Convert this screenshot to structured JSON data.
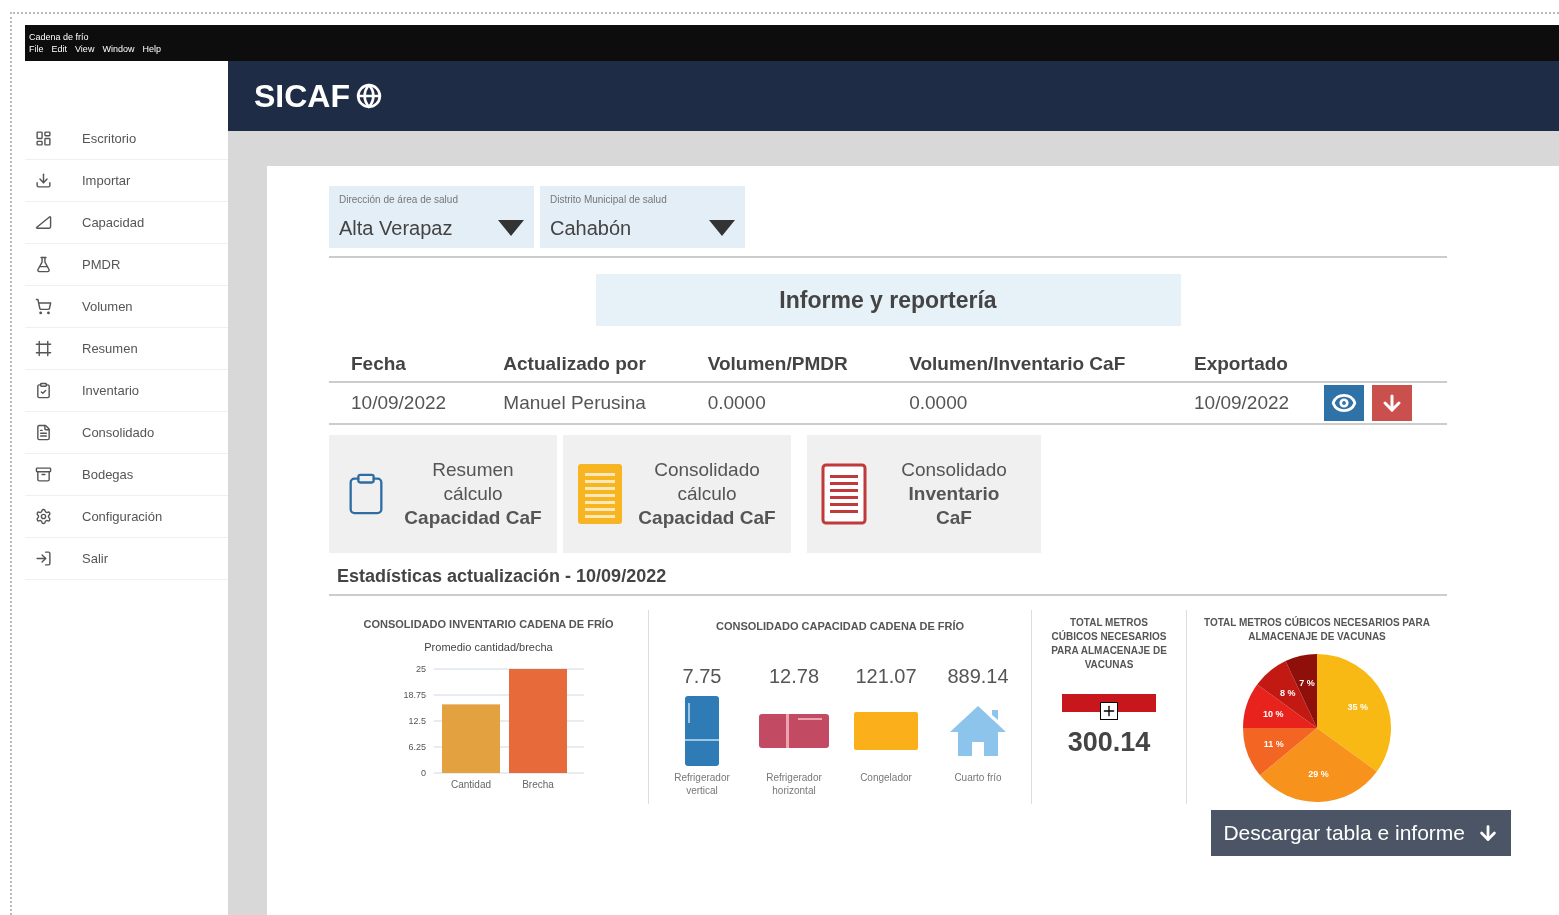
{
  "window": {
    "title": "Cadena de frío",
    "menu": [
      "File",
      "Edit",
      "View",
      "Window",
      "Help"
    ]
  },
  "header": {
    "logo": "SICAF"
  },
  "sidebar": {
    "items": [
      {
        "label": "Escritorio",
        "kind": "dashboard",
        "selected": false
      },
      {
        "label": "Importar",
        "kind": "import",
        "selected": false
      },
      {
        "label": "Capacidad",
        "kind": "capacity",
        "selected": false
      },
      {
        "label": "PMDR",
        "kind": "pmdr",
        "selected": false
      },
      {
        "label": "Volumen",
        "kind": "volume",
        "selected": false
      },
      {
        "label": "Resumen",
        "kind": "summary",
        "selected": false
      },
      {
        "label": "Inventario",
        "kind": "inventory",
        "selected": false
      },
      {
        "label": "Consolidado",
        "kind": "consolidated",
        "selected": false
      },
      {
        "label": "Bodegas",
        "kind": "warehouse",
        "selected": false
      },
      {
        "label": "Configuración",
        "kind": "settings",
        "selected": false
      },
      {
        "label": "Salir",
        "kind": "exit",
        "selected": false
      }
    ]
  },
  "filters": [
    {
      "label": "Dirección de área de salud",
      "value": "Alta Verapaz"
    },
    {
      "label": "Distrito Municipal de salud",
      "value": "Cahabón"
    }
  ],
  "section_title": "Informe y reportería",
  "table": {
    "columns": [
      "Fecha",
      "Actualizado por",
      "Volumen/PMDR",
      "Volumen/Inventario CaF",
      "Exportado"
    ],
    "rows": [
      {
        "cells": [
          "10/09/2022",
          "Manuel Perusina",
          "0.0000",
          "0.0000",
          "10/09/2022"
        ]
      }
    ]
  },
  "report_cards": [
    {
      "kind": "clipboard",
      "lines": [
        {
          "text": "Resumen",
          "bold": false
        },
        {
          "text": "cálculo",
          "bold": false
        },
        {
          "text": "Capacidad CaF",
          "bold": true
        }
      ]
    },
    {
      "kind": "list",
      "lines": [
        {
          "text": "Consolidado",
          "bold": false
        },
        {
          "text": "cálculo",
          "bold": false
        },
        {
          "text": "Capacidad CaF",
          "bold": true
        }
      ]
    },
    {
      "kind": "document",
      "lines": [
        {
          "text": "Consolidado",
          "bold": false
        },
        {
          "text": "Inventario",
          "bold": true
        },
        {
          "text": "CaF",
          "bold": true
        }
      ]
    }
  ],
  "stats_title": "Estadísticas actualización - 10/09/2022",
  "inventory_panel": {
    "title": "CONSOLIDADO INVENTARIO CADENA DE FRÍO",
    "chart_data": {
      "type": "bar",
      "grid": true,
      "title": "Promedio cantidad/brecha",
      "categories": [
        "Cantidad",
        "Brecha"
      ],
      "values": [
        16.5,
        25
      ],
      "ylim": [
        0,
        25
      ],
      "yticks": [
        0,
        {
          "value": 6.25,
          "label": "6.25"
        },
        {
          "value": 12.5,
          "label": "12.5"
        },
        {
          "value": 18.75,
          "label": "18.75"
        },
        25
      ]
    }
  },
  "capacity_panel": {
    "title": "CONSOLIDADO CAPACIDAD CADENA DE FRÍO",
    "items": [
      {
        "value": "7.75",
        "label": "Refrigerador vertical",
        "kind": "vertical"
      },
      {
        "value": "12.78",
        "label": "Refrigerador horizontal",
        "kind": "horizontal"
      },
      {
        "value": "121.07",
        "label": "Congelador",
        "kind": "freezer"
      },
      {
        "value": "889.14",
        "label": "Cuarto frío",
        "kind": "room"
      }
    ]
  },
  "total_panel": {
    "title": "TOTAL METROS CÚBICOS NECESARIOS PARA ALMACENAJE DE VACUNAS",
    "value": "300.14"
  },
  "pie_panel": {
    "title": "TOTAL METROS CÚBICOS NECESARIOS PARA ALMACENAJE DE VACUNAS",
    "chart_data": {
      "type": "pie",
      "values": [
        35,
        29,
        11,
        10,
        8,
        7
      ],
      "value_labels": [
        "35 %",
        "29 %",
        "11 %",
        "10 %",
        "8 %",
        "7 %"
      ]
    }
  },
  "download_button": "Descargar tabla e informe"
}
